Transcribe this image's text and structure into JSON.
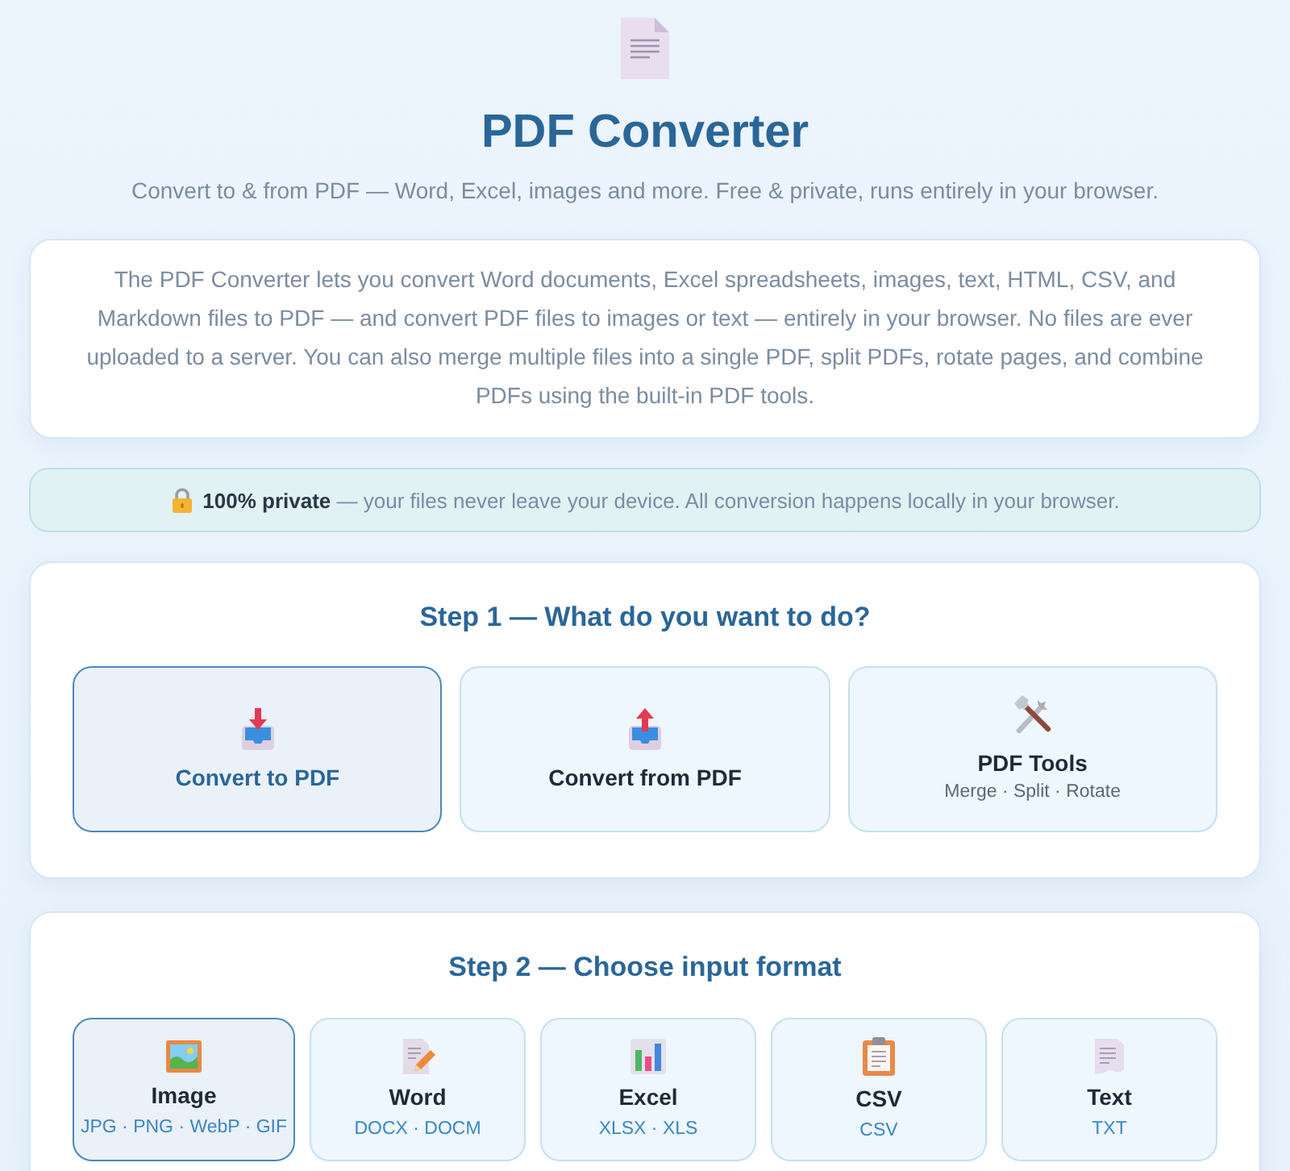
{
  "header": {
    "title": "PDF Converter",
    "subtitle": "Convert to & from PDF — Word, Excel, images and more. Free & private, runs entirely in your browser."
  },
  "intro": {
    "text": "The PDF Converter lets you convert Word documents, Excel spreadsheets, images, text, HTML, CSV, and Markdown files to PDF — and convert PDF files to images or text — entirely in your browser. No files are ever uploaded to a server. You can also merge multiple files into a single PDF, split PDFs, rotate pages, and combine PDFs using the built-in PDF tools."
  },
  "privacy_notice": {
    "text": "**100% private** — your files never leave your device. All conversion happens locally in your browser."
  },
  "step_1": {
    "heading": "Step 1 — What do you want to do?",
    "options": [
      {
        "kind": "to-pdf",
        "label": "Convert to PDF",
        "selected": true
      },
      {
        "kind": "from-pdf",
        "label": "Convert from PDF",
        "selected": false
      },
      {
        "kind": "tools",
        "label": "PDF Tools",
        "detail": "Merge · Split · Rotate",
        "selected": false
      }
    ]
  },
  "step_2": {
    "heading": "Step 2 — Choose input format",
    "formats": [
      {
        "kind": "image",
        "label": "Image",
        "extensions": "JPG · PNG · WebP · GIF",
        "selected": true
      },
      {
        "kind": "word",
        "label": "Word",
        "extensions": "DOCX · DOCM",
        "selected": false
      },
      {
        "kind": "excel",
        "label": "Excel",
        "extensions": "XLSX · XLS",
        "selected": false
      },
      {
        "kind": "csv",
        "label": "CSV",
        "extensions": "CSV",
        "selected": false
      },
      {
        "kind": "text",
        "label": "Text",
        "extensions": "TXT",
        "selected": false
      }
    ]
  }
}
